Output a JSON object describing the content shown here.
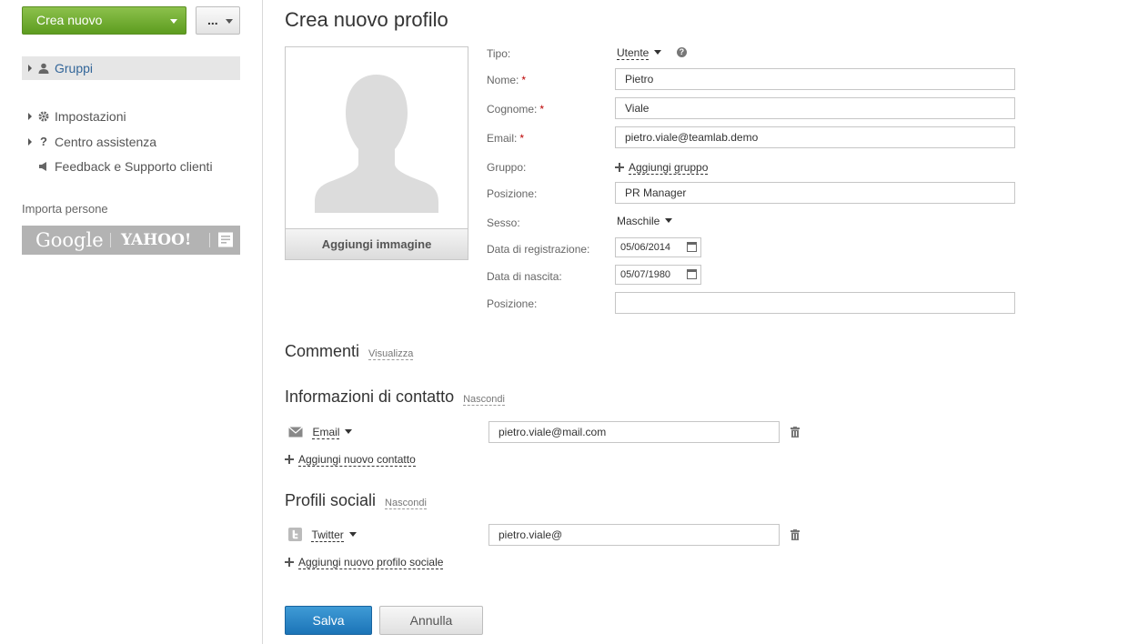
{
  "sidebar": {
    "create_label": "Crea nuovo",
    "more_label": "...",
    "groups_label": "Gruppi",
    "settings_label": "Impostazioni",
    "help_label": "Centro assistenza",
    "feedback_label": "Feedback e Supporto clienti",
    "import_title": "Importa persone",
    "import_google": "Google",
    "import_yahoo": "YAHOO!"
  },
  "form": {
    "title": "Crea nuovo profilo",
    "add_image_label": "Aggiungi immagine",
    "type_label": "Tipo:",
    "type_value": "Utente",
    "help_glyph": "?",
    "name_label": "Nome:",
    "name_value": "Pietro",
    "surname_label": "Cognome:",
    "surname_value": "Viale",
    "email_label": "Email:",
    "email_value": "pietro.viale@teamlab.demo",
    "required_mark": "*",
    "group_label": "Gruppo:",
    "add_group_label": "Aggiungi gruppo",
    "position_label": "Posizione:",
    "position_value": "PR Manager",
    "gender_label": "Sesso:",
    "gender_value": "Maschile",
    "regdate_label": "Data di registrazione:",
    "regdate_value": "05/06/2014",
    "birthdate_label": "Data di nascita:",
    "birthdate_value": "05/07/1980",
    "location_label": "Posizione:",
    "location_value": ""
  },
  "comments": {
    "title": "Commenti",
    "toggle": "Visualizza"
  },
  "contacts": {
    "title": "Informazioni di contatto",
    "toggle": "Nascondi",
    "type_label": "Email",
    "value": "pietro.viale@mail.com",
    "add_label": "Aggiungi nuovo contatto"
  },
  "social": {
    "title": "Profili sociali",
    "toggle": "Nascondi",
    "type_label": "Twitter",
    "value": "pietro.viale@",
    "add_label": "Aggiungi nuovo profilo sociale"
  },
  "actions": {
    "save": "Salva",
    "cancel": "Annulla"
  },
  "colors": {
    "create_green": "#6aab2b",
    "save_blue": "#2a86c8",
    "active_bg": "#e6e6e6",
    "import_gray": "#b3b3b3"
  }
}
